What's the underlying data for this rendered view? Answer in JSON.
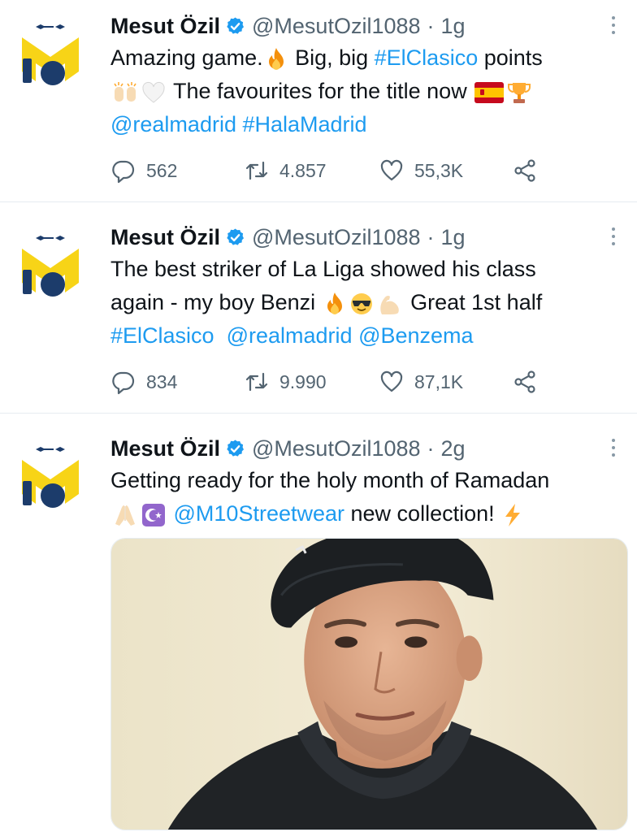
{
  "colors": {
    "link": "#1d9bf0",
    "muted": "#536471",
    "avatar_yellow": "#f7d417",
    "avatar_navy": "#1c3c6b"
  },
  "tweets": [
    {
      "name": "Mesut Özil",
      "handle": "@MesutOzil1088",
      "sep": "·",
      "time": "1g",
      "text": {
        "l1a": "Amazing game.",
        "l1b": " Big, big ",
        "l1tag": "#ElClasico",
        "l1c": " points",
        "l2a": " The favourites for the title now ",
        "l3a": "@realmadrid",
        "l3b": " ",
        "l3c": "#HalaMadrid"
      },
      "stats": {
        "replies": "562",
        "retweets": "4.857",
        "likes": "55,3K"
      }
    },
    {
      "name": "Mesut Özil",
      "handle": "@MesutOzil1088",
      "sep": "·",
      "time": "1g",
      "text": {
        "l1a": "The best striker of La Liga showed his class",
        "l2a": "again - my boy Benzi ",
        "l2b": " Great 1st half",
        "l3a": "#ElClasico",
        "l3b": "  ",
        "l3c": "@realmadrid",
        "l3d": " ",
        "l3e": "@Benzema"
      },
      "stats": {
        "replies": "834",
        "retweets": "9.990",
        "likes": "87,1K"
      }
    },
    {
      "name": "Mesut Özil",
      "handle": "@MesutOzil1088",
      "sep": "·",
      "time": "2g",
      "text": {
        "l1a": "Getting ready for the holy month of Ramadan",
        "l2a": " ",
        "l2b": "@M10Streetwear",
        "l2c": " new collection! "
      }
    }
  ],
  "icons": {
    "avatar": "m10-logo-icon",
    "verified": "verified-badge-icon",
    "more": "more-vertical-icon",
    "reply": "reply-icon",
    "retweet": "retweet-icon",
    "like": "like-icon",
    "share": "share-icon",
    "emojis": [
      "fire",
      "raising-hands",
      "white-heart",
      "spain-flag",
      "trophy",
      "smiling-face-with-sunglasses",
      "flexed-biceps",
      "folded-hands",
      "star-and-crescent",
      "high-voltage"
    ]
  }
}
